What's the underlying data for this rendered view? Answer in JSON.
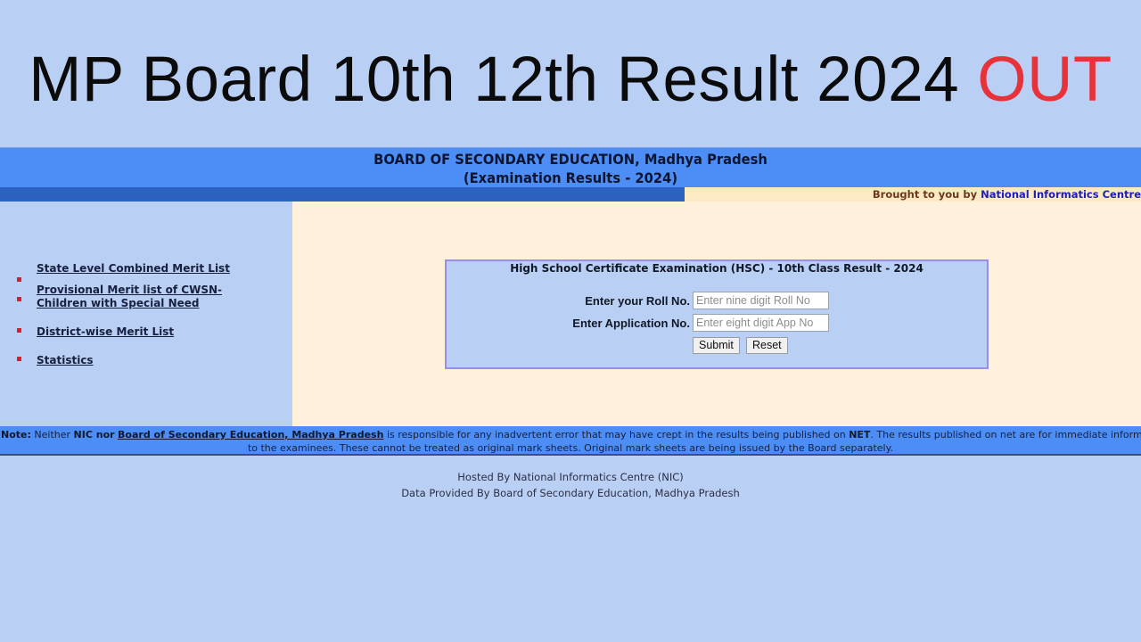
{
  "headline": {
    "text": "MP Board 10th 12th Result 2024",
    "accent": "OUT",
    "accent_color": "#e8323a"
  },
  "header": {
    "title_line1": "BOARD OF SECONDARY EDUCATION, Madhya Pradesh",
    "title_line2": "(Examination Results - 2024)",
    "brought_by": "Brought to you by",
    "brought_by_org": "National Informatics Centre"
  },
  "sidebar": {
    "items": [
      {
        "label": "State Level Combined Merit List"
      },
      {
        "label_line1": "Provisional Merit list of CWSN-",
        "label_line2": "Children with Special Need"
      },
      {
        "label": "District-wise Merit List"
      },
      {
        "label": "Statistics"
      }
    ]
  },
  "form": {
    "title": "High School Certificate Examination (HSC) - 10th Class Result - 2024",
    "roll_label": "Enter your Roll No.",
    "roll_placeholder": "Enter nine digit Roll No",
    "roll_value": "",
    "app_label": "Enter Application No.",
    "app_placeholder": "Enter eight digit App No",
    "app_value": "",
    "submit_label": "Submit",
    "reset_label": "Reset"
  },
  "note": {
    "prefix": "Note:",
    "neither": "Neither",
    "nic_nor": "NIC nor",
    "board_link": "Board of Secondary Education, Madhya Pradesh",
    "text1": "is responsible for any inadvertent error that may have crept in the results being published on",
    "net": "NET",
    "text2": ". The results published on net are for immediate information",
    "line2": "to the examinees. These cannot be treated as original mark sheets. Original mark sheets are being issued by the Board separately."
  },
  "footer": {
    "hosted": "Hosted By National Informatics Centre (NIC)",
    "data_provided": "Data Provided By Board of Secondary Education, Madhya Pradesh"
  },
  "colors": {
    "page_bg": "#bacff4",
    "header_blue": "#4d8ef6",
    "dark_blue": "#2b62bf",
    "cream": "#fff1dc",
    "bullet_red": "#d3202c"
  }
}
